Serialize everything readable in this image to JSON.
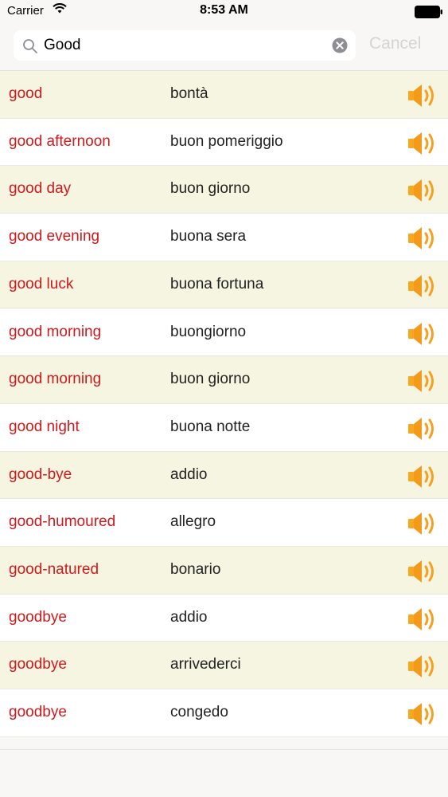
{
  "status_bar": {
    "carrier": "Carrier",
    "time": "8:53 AM",
    "wifi_icon": "wifi-icon",
    "battery_icon": "battery-icon"
  },
  "search": {
    "value": "Good",
    "cancel_label": "Cancel",
    "search_icon": "magnifier-icon",
    "clear_icon": "clear-x-icon"
  },
  "colors": {
    "term": "#d0191d",
    "translation": "#222222",
    "row_alt": "#f5f5e1",
    "row_plain": "#ffffff",
    "speaker": "#f5a020"
  },
  "results": [
    {
      "term": "good",
      "translation": "bontà"
    },
    {
      "term": "good afternoon",
      "translation": "buon pomeriggio"
    },
    {
      "term": "good day",
      "translation": "buon giorno"
    },
    {
      "term": "good evening",
      "translation": "buona sera"
    },
    {
      "term": "good luck",
      "translation": "buona fortuna"
    },
    {
      "term": "good morning",
      "translation": "buongiorno"
    },
    {
      "term": "good morning",
      "translation": "buon giorno"
    },
    {
      "term": "good night",
      "translation": "buona notte"
    },
    {
      "term": "good-bye",
      "translation": "addio"
    },
    {
      "term": "good-humoured",
      "translation": "allegro"
    },
    {
      "term": "good-natured",
      "translation": "bonario"
    },
    {
      "term": "goodbye",
      "translation": "addio"
    },
    {
      "term": "goodbye",
      "translation": "arrivederci"
    },
    {
      "term": "goodbye",
      "translation": "congedo"
    }
  ]
}
